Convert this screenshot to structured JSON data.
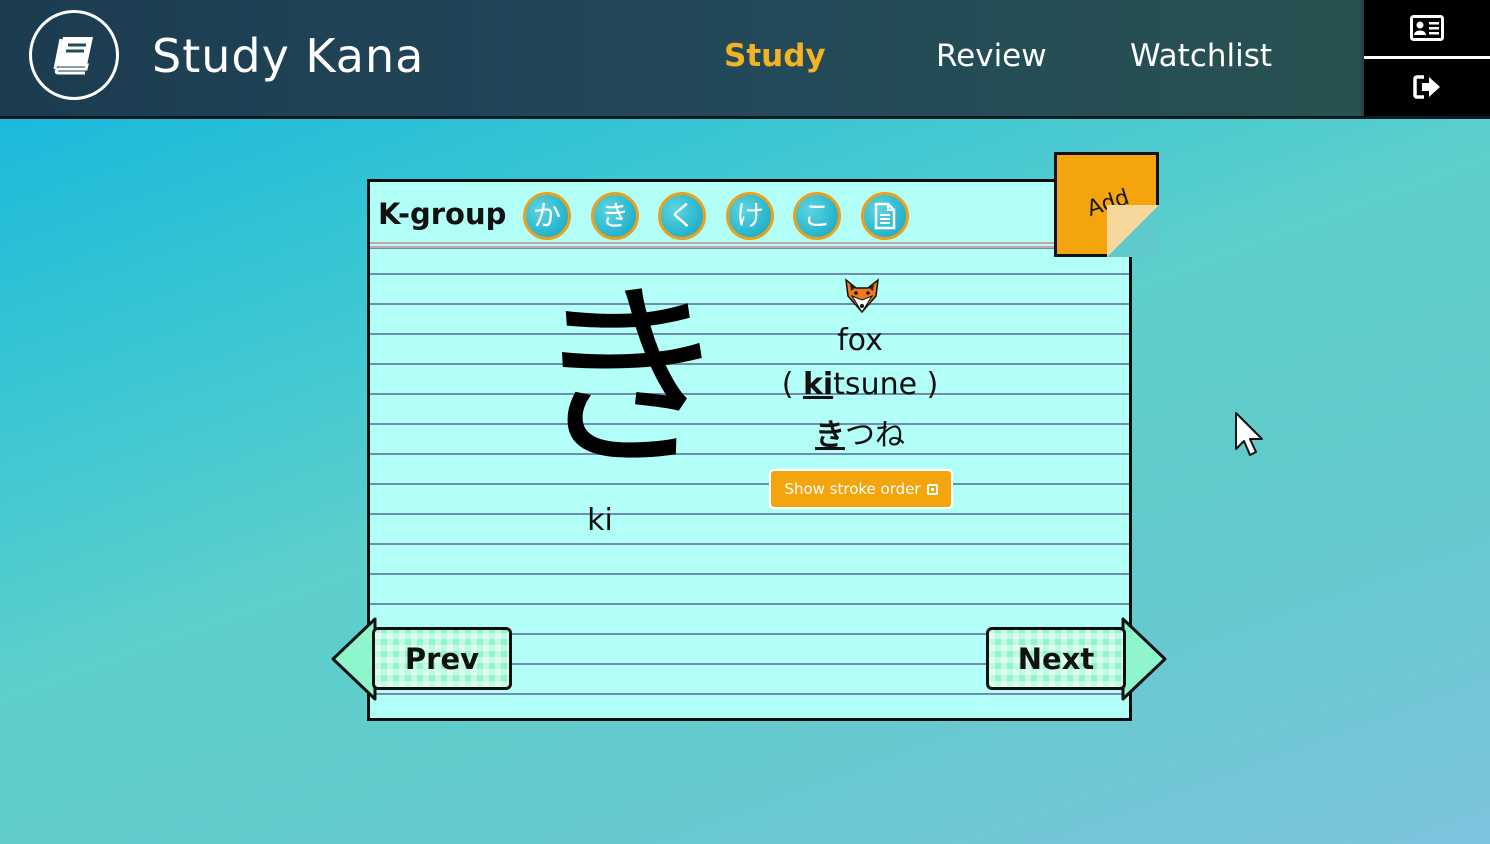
{
  "header": {
    "app_title": "Study Kana",
    "logo_icon": "book-icon",
    "nav": [
      {
        "label": "Study",
        "active": true
      },
      {
        "label": "Review",
        "active": false
      },
      {
        "label": "Watchlist",
        "active": false
      }
    ],
    "side_buttons": [
      {
        "icon": "profile-card-icon"
      },
      {
        "icon": "logout-icon"
      }
    ]
  },
  "card": {
    "group_label": "K-group",
    "kana_chips": [
      "か",
      "き",
      "く",
      "け",
      "こ"
    ],
    "list_icon": "document-icon",
    "sticky_label": "Add",
    "kana": "き",
    "romaji": "ki",
    "word_icon": "fox-icon",
    "meaning": "fox",
    "reading_open": "( ",
    "reading_bold": "ki",
    "reading_rest": "tsune",
    "reading_close": " )",
    "kana_word_bold": "き",
    "kana_word_rest": "つね",
    "stroke_button": "Show stroke order"
  },
  "navigation": {
    "prev": "Prev",
    "next": "Next"
  },
  "colors": {
    "accent": "#f4a40c",
    "active_nav": "#f4b324",
    "card_bg": "#b2fff8",
    "chip_bg": "#2bb8cf",
    "nav_button": "#8ff5cc"
  }
}
